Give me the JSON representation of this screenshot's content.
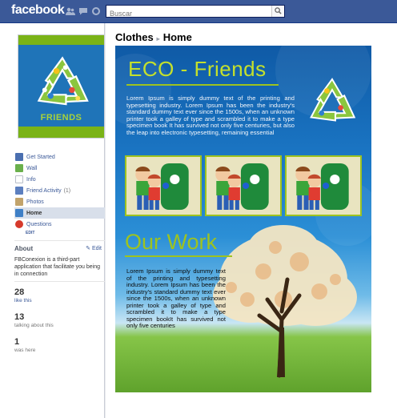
{
  "topbar": {
    "logo": "facebook",
    "search_placeholder": "Buscar",
    "icons": [
      "friend-requests-icon",
      "messages-icon",
      "notifications-icon"
    ]
  },
  "profile": {
    "picture_label": "FRIENDS"
  },
  "nav": {
    "items": [
      {
        "label": "Get Started",
        "icon": "get-started-icon",
        "count": ""
      },
      {
        "label": "Wall",
        "icon": "wall-icon",
        "count": ""
      },
      {
        "label": "Info",
        "icon": "info-icon",
        "count": ""
      },
      {
        "label": "Friend Activity",
        "icon": "friend-activity-icon",
        "count": "(1)"
      },
      {
        "label": "Photos",
        "icon": "photos-icon",
        "count": ""
      },
      {
        "label": "Home",
        "icon": "home-icon",
        "count": ""
      },
      {
        "label": "Questions",
        "icon": "questions-icon",
        "count": ""
      }
    ],
    "active": "Home",
    "edit_label": "EDIT"
  },
  "about": {
    "heading": "About",
    "edit_label": "Edit",
    "text": "FBConexion is a third-part application that facilitate you being in connection"
  },
  "stats": [
    {
      "number": "28",
      "label": "like this"
    },
    {
      "number": "13",
      "label": "talking about this"
    },
    {
      "number": "1",
      "label": "was here"
    }
  ],
  "breadcrumb": {
    "page": "Clothes",
    "tab": "Home"
  },
  "tab": {
    "title": "ECO - Friends",
    "intro_text": "Lorem Ipsum is simply dummy text of the printing and typesetting industry. Lorem Ipsum has been the industry's standard dummy text ever since the 1500s, when an unknown printer took a galley of type and scrambled it to make a type specimen book It has survived not only five centuries, but also the leap into electronic typesetting, remaining essential",
    "section_title": "Our Work",
    "work_text": "Lorem Ipsum is simply dummy text of the printing and typesetting industry. Lorem Ipsum has been the industry's standard dummy text ever since the 1500s, when an unknown printer took a galley of type and scrambled it to make a type specimen bookIt has survived not only five centuries"
  },
  "colors": {
    "facebook_blue": "#3b5998",
    "eco_green": "#9ec31f",
    "eco_title": "#c4e02c",
    "sky_blue": "#1a74c2"
  }
}
